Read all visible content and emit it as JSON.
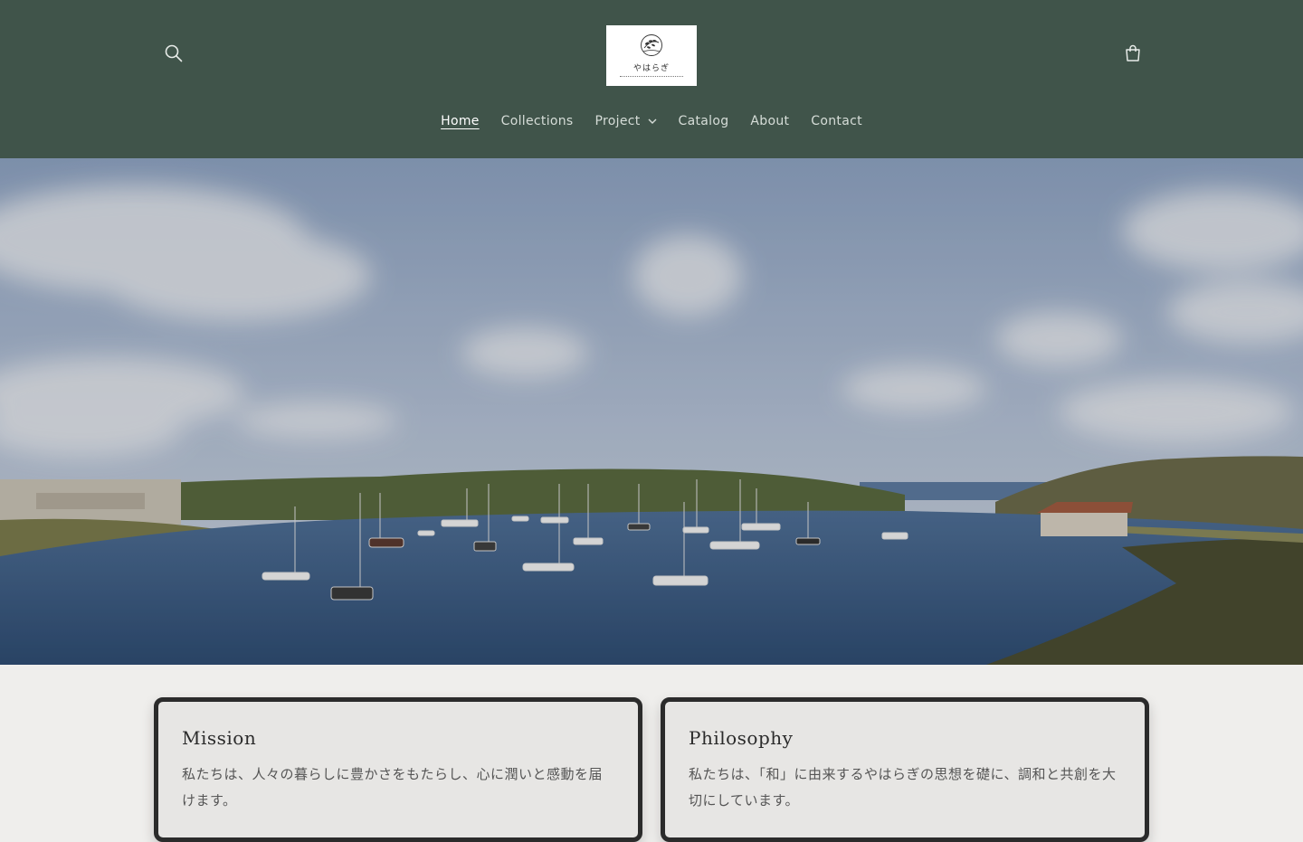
{
  "header": {
    "logo_text": "やはらぎ",
    "search_icon": "search-icon",
    "cart_icon": "cart-icon"
  },
  "nav": {
    "items": [
      {
        "label": "Home",
        "active": true
      },
      {
        "label": "Collections"
      },
      {
        "label": "Project",
        "has_dropdown": true
      },
      {
        "label": "Catalog"
      },
      {
        "label": "About"
      },
      {
        "label": "Contact"
      }
    ]
  },
  "hero": {
    "image_subject": "harbor-photo"
  },
  "cards": [
    {
      "title": "Mission",
      "body": "私たちは、人々の暮らしに豊かさをもたらし、心に潤いと感動を届けます。"
    },
    {
      "title": "Philosophy",
      "body": "私たちは、「和」に由来するやはらぎの思想を礎に、調和と共創を大切にしています。"
    }
  ],
  "colors": {
    "header_bg": "#40544a",
    "page_bg": "#efeeec",
    "card_border": "#2b2b2b"
  }
}
